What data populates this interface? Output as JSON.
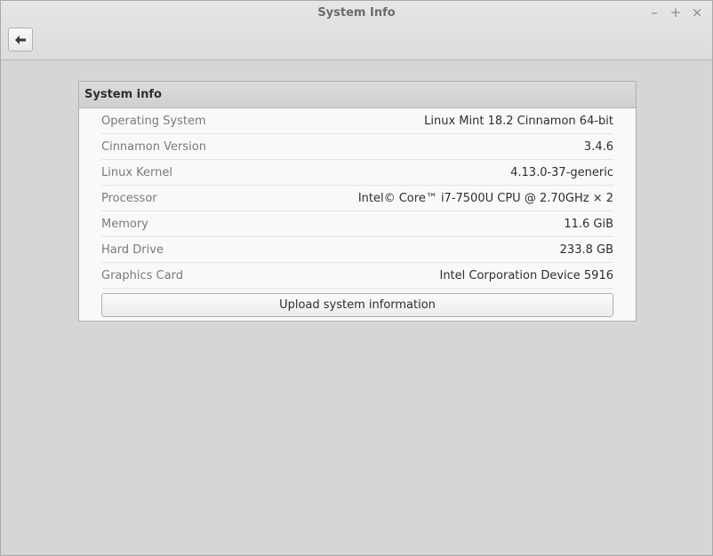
{
  "window": {
    "title": "System Info",
    "controls": {
      "minimize": "–",
      "maximize": "+",
      "close": "×"
    }
  },
  "toolbar": {
    "back_icon": "back-arrow-icon"
  },
  "panel": {
    "header": "System info",
    "rows": [
      {
        "label": "Operating System",
        "value": "Linux Mint 18.2 Cinnamon 64-bit"
      },
      {
        "label": "Cinnamon Version",
        "value": "3.4.6"
      },
      {
        "label": "Linux Kernel",
        "value": "4.13.0-37-generic"
      },
      {
        "label": "Processor",
        "value": "Intel© Core™ i7-7500U CPU @ 2.70GHz × 2"
      },
      {
        "label": "Memory",
        "value": "11.6 GiB"
      },
      {
        "label": "Hard Drive",
        "value": "233.8 GB"
      },
      {
        "label": "Graphics Card",
        "value": "Intel Corporation Device 5916"
      }
    ],
    "upload_label": "Upload system information"
  }
}
